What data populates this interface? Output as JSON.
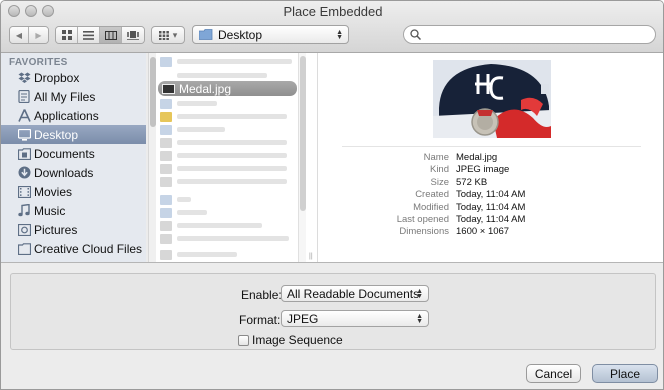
{
  "window": {
    "title": "Place Embedded"
  },
  "toolbar": {
    "back_glyph": "◀",
    "forward_glyph": "▶",
    "view_modes": [
      "icon-view",
      "list-view",
      "column-view",
      "coverflow-view"
    ],
    "active_view_index": 2,
    "arrange_glyph": "▾",
    "location": "Desktop",
    "search_placeholder": ""
  },
  "sidebar": {
    "heading": "FAVORITES",
    "items": [
      {
        "label": "Dropbox",
        "icon": "dropbox-icon",
        "selected": false
      },
      {
        "label": "All My Files",
        "icon": "all-files-icon",
        "selected": false
      },
      {
        "label": "Applications",
        "icon": "applications-icon",
        "selected": false
      },
      {
        "label": "Desktop",
        "icon": "desktop-icon",
        "selected": true
      },
      {
        "label": "Documents",
        "icon": "documents-icon",
        "selected": false
      },
      {
        "label": "Downloads",
        "icon": "downloads-icon",
        "selected": false
      },
      {
        "label": "Movies",
        "icon": "movies-icon",
        "selected": false
      },
      {
        "label": "Music",
        "icon": "music-icon",
        "selected": false
      },
      {
        "label": "Pictures",
        "icon": "pictures-icon",
        "selected": false
      },
      {
        "label": "Creative Cloud Files",
        "icon": "creative-cloud-icon",
        "selected": false
      }
    ]
  },
  "files": {
    "selected": "Medal.jpg"
  },
  "preview": {
    "image_icon": "medal-photo-thumbnail",
    "info": [
      {
        "key": "Name",
        "value": "Medal.jpg"
      },
      {
        "key": "Kind",
        "value": "JPEG image"
      },
      {
        "key": "Size",
        "value": "572 KB"
      },
      {
        "key": "Created",
        "value": "Today, 11:04 AM"
      },
      {
        "key": "Modified",
        "value": "Today, 11:04 AM"
      },
      {
        "key": "Last opened",
        "value": "Today, 11:04 AM"
      },
      {
        "key": "Dimensions",
        "value": "1600 × 1067"
      }
    ]
  },
  "options": {
    "enable_label": "Enable:",
    "enable_value": "All Readable Documents",
    "format_label": "Format:",
    "format_value": "JPEG",
    "image_sequence_label": "Image Sequence",
    "image_sequence_checked": false
  },
  "buttons": {
    "cancel": "Cancel",
    "place": "Place"
  },
  "colors": {
    "sidebar_selection": "#7f91ad",
    "file_selection": "#9a9a9a",
    "default_button": "#c4cfdd"
  }
}
